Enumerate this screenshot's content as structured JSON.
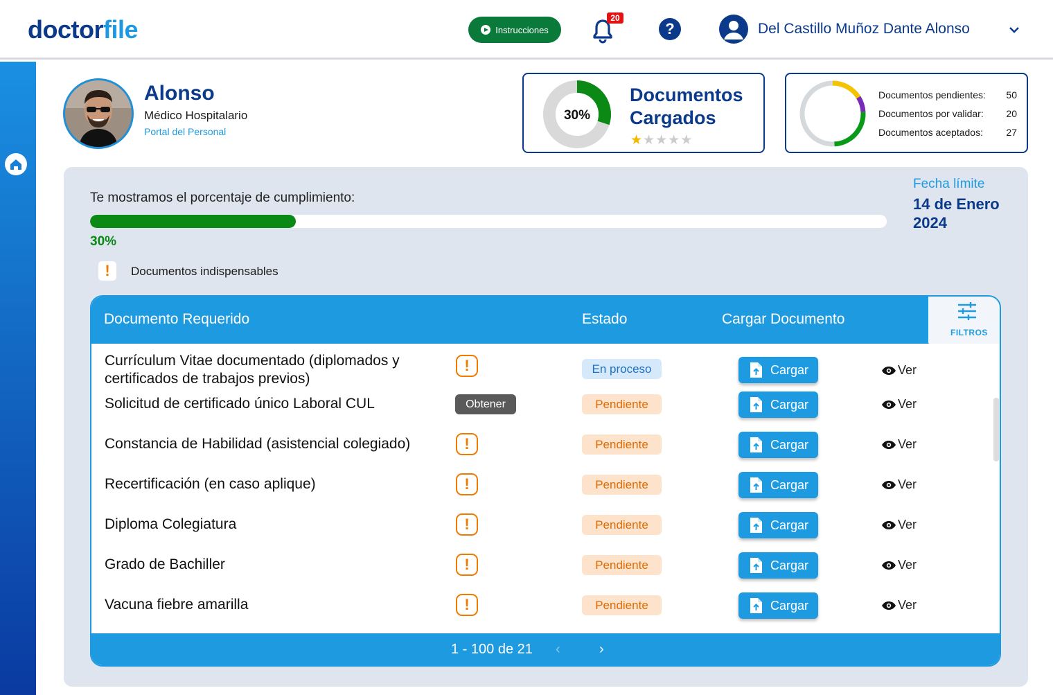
{
  "header": {
    "logo_a": "doctor",
    "logo_b": "file",
    "instructions_label": "Instrucciones",
    "notification_count": "20",
    "help_symbol": "?",
    "user_name": "Del Castillo Muñoz Dante Alonso"
  },
  "profile": {
    "name": "Alonso",
    "role": "Médico Hospitalario",
    "portal": "Portal del Personal"
  },
  "summary_card": {
    "percent_label": "30%",
    "percent_value": 30,
    "title_line1": "Documentos",
    "title_line2": "Cargados",
    "stars_filled": 1,
    "stars_total": 5
  },
  "stats_card": {
    "items": [
      {
        "label": "Documentos pendientes:",
        "value": "50",
        "color": "#f5c400"
      },
      {
        "label": "Documentos por validar:",
        "value": "20",
        "color": "#7a2cb8"
      },
      {
        "label": "Documentos aceptados:",
        "value": "27",
        "color": "#0a9a1a"
      }
    ]
  },
  "compliance": {
    "label": "Te mostramos el porcentaje de cumplimiento:",
    "percent_label": "30%",
    "percent_value": 30,
    "deadline_label": "Fecha límite",
    "deadline_date": "14 de Enero 2024",
    "legend_symbol": "!",
    "legend_text": "Documentos indispensables"
  },
  "table": {
    "columns": {
      "document": "Documento Requerido",
      "status": "Estado",
      "upload": "Cargar Documento",
      "filters": "FILTROS"
    },
    "upload_label": "Cargar",
    "view_label": "Ver",
    "rows": [
      {
        "doc": "Currículum Vitae documentado (diplomados y certificados de trabajos previos)",
        "flag": "warn",
        "status": "En proceso",
        "status_type": "proc"
      },
      {
        "doc": "Solicitud de certificado único Laboral CUL",
        "flag": "obtener",
        "flag_label": "Obtener",
        "status": "Pendiente",
        "status_type": "pend"
      },
      {
        "doc": "Constancia de Habilidad (asistencial colegiado)",
        "flag": "warn",
        "status": "Pendiente",
        "status_type": "pend"
      },
      {
        "doc": "Recertificación (en caso aplique)",
        "flag": "warn",
        "status": "Pendiente",
        "status_type": "pend"
      },
      {
        "doc": "Diploma Colegiatura",
        "flag": "warn",
        "status": "Pendiente",
        "status_type": "pend"
      },
      {
        "doc": "Grado de Bachiller",
        "flag": "warn",
        "status": "Pendiente",
        "status_type": "pend"
      },
      {
        "doc": "Vacuna fiebre amarilla",
        "flag": "warn",
        "status": "Pendiente",
        "status_type": "pend"
      }
    ],
    "pagination": "1 - 100 de 21",
    "prev_symbol": "‹",
    "next_symbol": "›"
  }
}
